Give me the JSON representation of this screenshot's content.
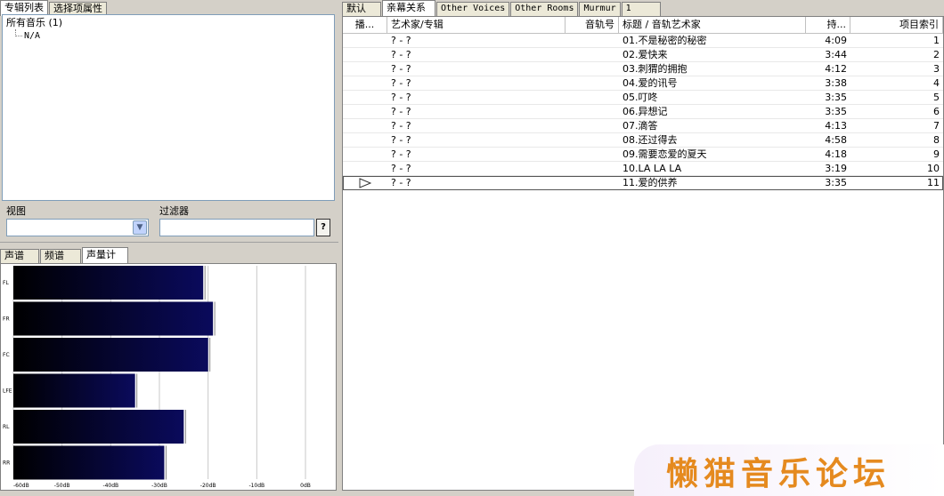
{
  "left": {
    "top_tabs": [
      "专辑列表",
      "选择项属性"
    ],
    "tree": {
      "root": "所有音乐 (1)",
      "child": "N/A"
    },
    "view_label": "视图",
    "view_value": "",
    "filter_label": "过滤器",
    "filter_value": "",
    "filter_help": "?",
    "vis_tabs": [
      "声谱",
      "频谱",
      "声量计"
    ],
    "meter": {
      "channels": [
        "FL",
        "FR",
        "FC",
        "LFE",
        "RL",
        "RR"
      ],
      "levels_db": [
        -21,
        -19,
        -20,
        -35,
        -25,
        -29
      ],
      "axis_labels": [
        "-60dB",
        "-50dB",
        "-40dB",
        "-30dB",
        "-20dB",
        "-10dB",
        "0dB"
      ],
      "axis_min_db": -60,
      "axis_max_db": 0,
      "bar_color_dark": "#000000",
      "bar_color_light": "#0a0a5c"
    }
  },
  "right": {
    "tabs": [
      "默认",
      "亲幕关系",
      "Other Voices",
      "Other Rooms",
      "Murmur",
      "1"
    ],
    "columns": [
      "播...",
      "艺术家/专辑",
      "音轨号",
      "标题 / 音轨艺术家",
      "持...",
      "项目索引"
    ],
    "rows": [
      {
        "artist": "? - ?",
        "title": "01.不是秘密的秘密",
        "dur": "4:09",
        "idx": "1"
      },
      {
        "artist": "? - ?",
        "title": "02.爱快来",
        "dur": "3:44",
        "idx": "2"
      },
      {
        "artist": "? - ?",
        "title": "03.刺猬的拥抱",
        "dur": "4:12",
        "idx": "3"
      },
      {
        "artist": "? - ?",
        "title": "04.爱的讯号",
        "dur": "3:38",
        "idx": "4"
      },
      {
        "artist": "? - ?",
        "title": "05.叮咚",
        "dur": "3:35",
        "idx": "5"
      },
      {
        "artist": "? - ?",
        "title": "06.异想记",
        "dur": "3:35",
        "idx": "6"
      },
      {
        "artist": "? - ?",
        "title": "07.滴答",
        "dur": "4:13",
        "idx": "7"
      },
      {
        "artist": "? - ?",
        "title": "08.还过得去",
        "dur": "4:58",
        "idx": "8"
      },
      {
        "artist": "? - ?",
        "title": "09.需要恋爱的夏天",
        "dur": "4:18",
        "idx": "9"
      },
      {
        "artist": "? - ?",
        "title": "10.LA LA LA",
        "dur": "3:19",
        "idx": "10"
      },
      {
        "artist": "? - ?",
        "title": "11.爱的供养",
        "dur": "3:35",
        "idx": "11",
        "playing": true
      }
    ]
  },
  "watermark": "懒猫音乐论坛"
}
